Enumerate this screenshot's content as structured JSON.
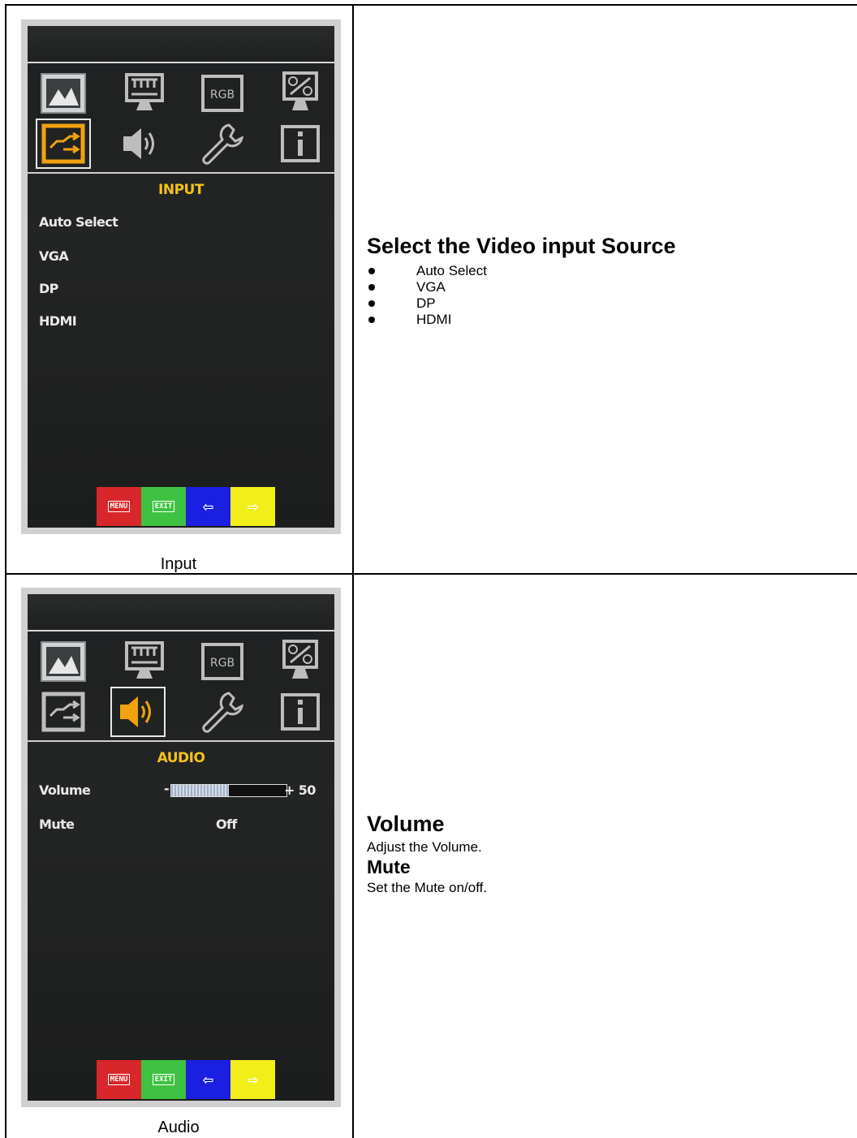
{
  "input_section": {
    "menu_title": "INPUT",
    "items": [
      "Auto Select",
      "VGA",
      "DP",
      "HDMI"
    ],
    "selected_icon": "input-icon",
    "caption": "Input",
    "heading": "Select the Video input Source",
    "bullets": [
      "Auto Select",
      "VGA",
      "DP",
      "HDMI"
    ]
  },
  "audio_section": {
    "menu_title": "AUDIO",
    "volume_label": "Volume",
    "volume_minus": "-",
    "volume_value": "+ 50",
    "volume_level": 0.5,
    "mute_label": "Mute",
    "mute_value": "Off",
    "selected_icon": "audio-icon",
    "caption": "Audio",
    "heading_volume": "Volume",
    "desc_volume": "Adjust the Volume.",
    "heading_mute": "Mute",
    "desc_mute": "Set the Mute on/off."
  },
  "osd_icons": [
    "picture-icon",
    "display-icon",
    "rgb-icon",
    "zoom-display-icon",
    "input-icon",
    "audio-icon",
    "wrench-icon",
    "info-icon"
  ],
  "button_labels": {
    "menu": "MENU",
    "exit": "EXIT",
    "left": "⇦",
    "right": "⇨"
  },
  "colors": {
    "osd_title": "#f3c318",
    "btn_menu": "#d8262b",
    "btn_exit": "#3fc241",
    "btn_left": "#1b1fe0",
    "btn_right": "#f2ee1a"
  }
}
